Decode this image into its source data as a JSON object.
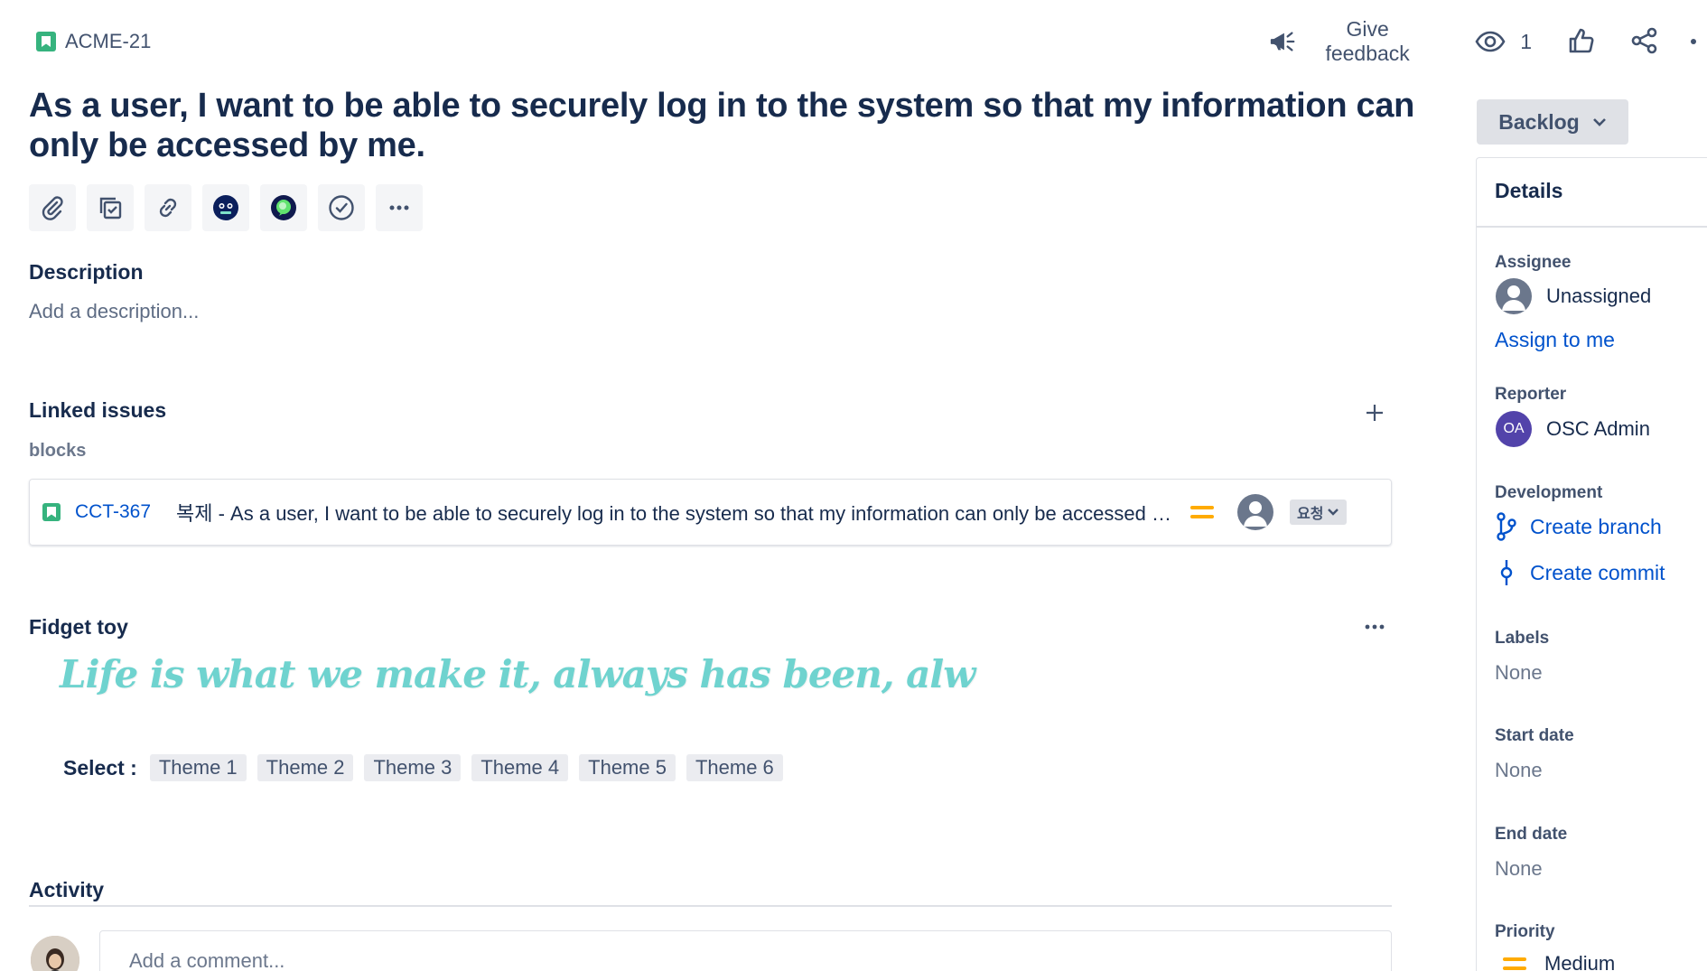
{
  "header": {
    "issue_key": "ACME-21",
    "give_feedback": "Give feedback",
    "watch_count": "1"
  },
  "title": "As a user, I want to be able to securely log in to the system so that my information can only be accessed by me.",
  "toolbar": {
    "icons": [
      "paperclip-icon",
      "checklist-icon",
      "link-icon",
      "app-face-icon",
      "app-bubble-icon",
      "check-circle-icon",
      "more-icon"
    ]
  },
  "description": {
    "title": "Description",
    "placeholder": "Add a description..."
  },
  "linked_issues": {
    "title": "Linked issues",
    "relation": "blocks",
    "items": [
      {
        "key": "CCT-367",
        "summary": "복제 - As a user, I want to be able to securely log in to the system so that my information can only be accessed by me.",
        "status": "요청",
        "priority_color": "#ffab00"
      }
    ]
  },
  "fidget": {
    "title": "Fidget toy",
    "quote": "Life is what we make it, always has been, alw",
    "select_label": "Select :",
    "themes": [
      "Theme 1",
      "Theme 2",
      "Theme 3",
      "Theme 4",
      "Theme 5",
      "Theme 6"
    ]
  },
  "activity": {
    "title": "Activity",
    "comment_placeholder": "Add a comment..."
  },
  "sidebar": {
    "status": "Backlog",
    "details_title": "Details",
    "assignee_label": "Assignee",
    "assignee_value": "Unassigned",
    "assign_to_me": "Assign to me",
    "reporter_label": "Reporter",
    "reporter_initials": "OA",
    "reporter_name": "OSC Admin",
    "development_label": "Development",
    "create_branch": "Create branch",
    "create_commit": "Create commit",
    "labels_label": "Labels",
    "labels_value": "None",
    "start_date_label": "Start date",
    "start_date_value": "None",
    "end_date_label": "End date",
    "end_date_value": "None",
    "priority_label": "Priority",
    "priority_value": "Medium"
  },
  "colors": {
    "link": "#0052cc",
    "story": "#36b37e",
    "priority_medium": "#ffab00",
    "reporter_avatar": "#5243aa",
    "fidget_text": "#6fd3cf"
  }
}
